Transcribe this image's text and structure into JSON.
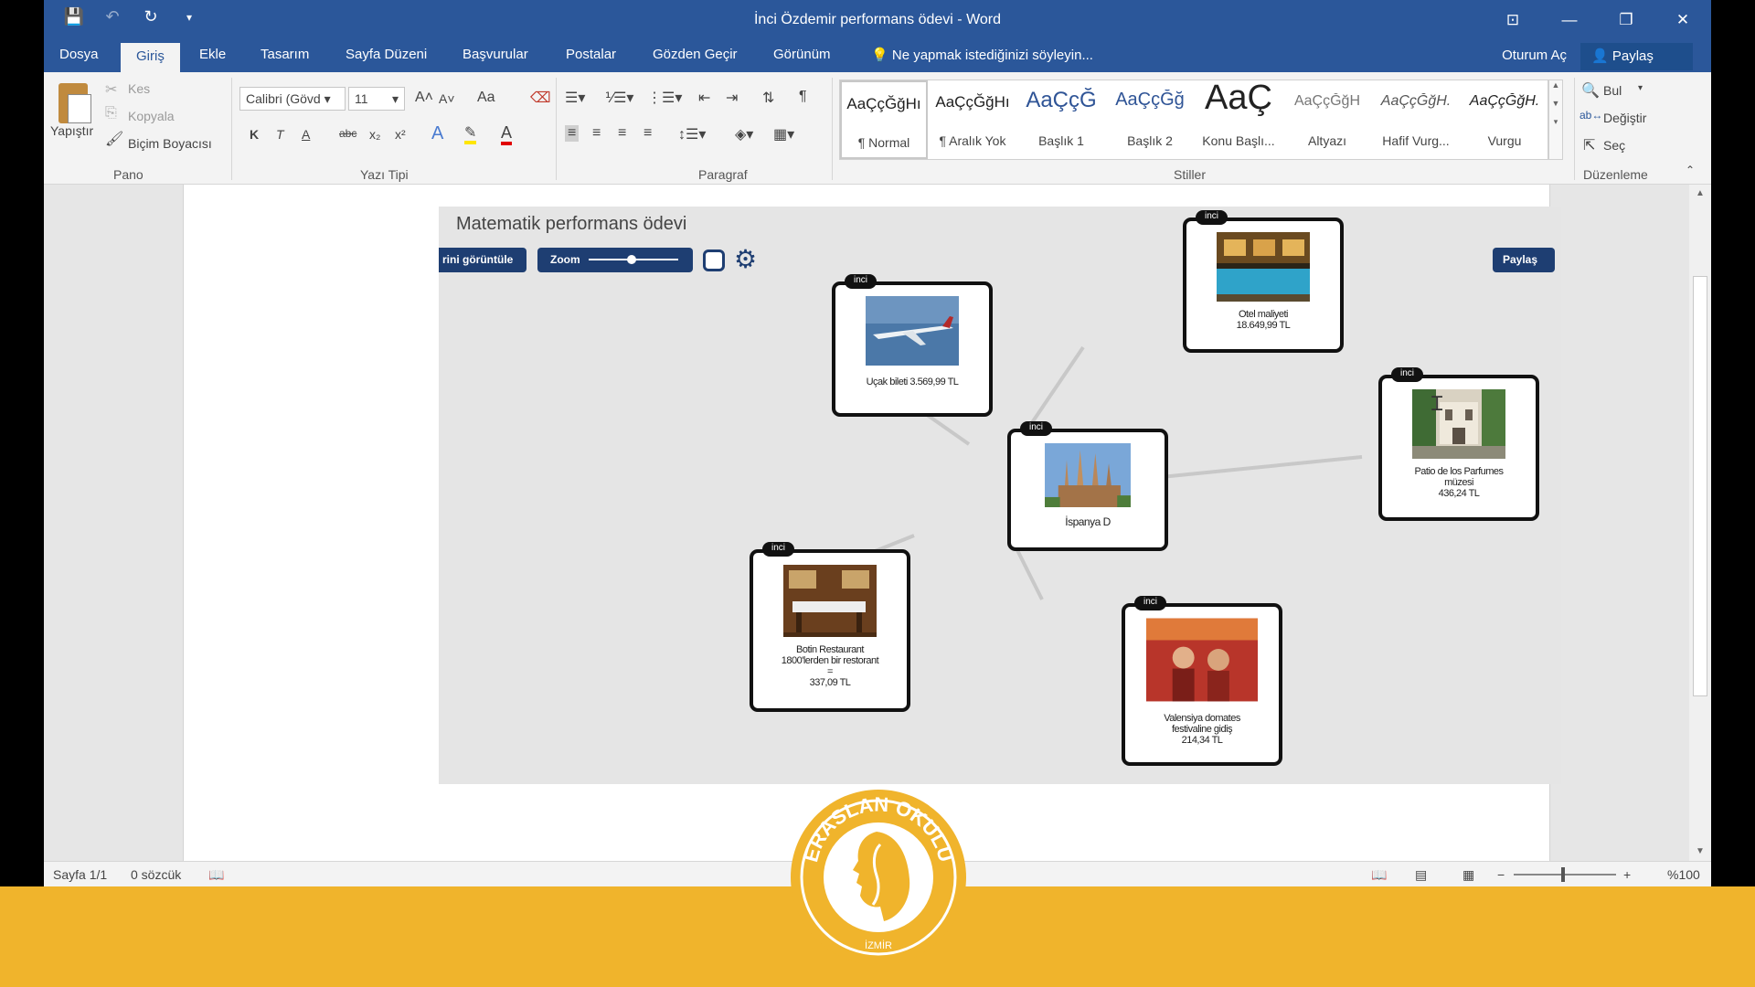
{
  "window": {
    "title": "İnci Özdemir performans ödevi - Word",
    "qat": {
      "save_icon": "save-icon",
      "undo_icon": "undo-icon",
      "redo_icon": "redo-icon",
      "customize_icon": "chevron-down-icon"
    },
    "controls": {
      "ribbon_display": "⊡",
      "minimize": "—",
      "restore": "❐",
      "close": "✕"
    }
  },
  "tabs": [
    {
      "label": "Dosya"
    },
    {
      "label": "Giriş"
    },
    {
      "label": "Ekle"
    },
    {
      "label": "Tasarım"
    },
    {
      "label": "Sayfa Düzeni"
    },
    {
      "label": "Başvurular"
    },
    {
      "label": "Postalar"
    },
    {
      "label": "Gözden Geçir"
    },
    {
      "label": "Görünüm"
    }
  ],
  "tell_me": "Ne yapmak istediğinizi söyleyin...",
  "account": "Oturum Aç",
  "share": "Paylaş",
  "ribbon": {
    "clipboard": {
      "label": "Pano",
      "paste": "Yapıştır",
      "cut": "Kes",
      "copy": "Kopyala",
      "format_painter": "Biçim Boyacısı"
    },
    "font": {
      "label": "Yazı Tipi",
      "font_name": "Calibri (Gövd",
      "font_size": "11",
      "bold": "K",
      "italic": "T",
      "underline": "A",
      "strike": "abc",
      "sub": "x₂",
      "sup": "x²",
      "case": "Aa",
      "grow": "A˄",
      "shrink": "A˅"
    },
    "paragraph": {
      "label": "Paragraf"
    },
    "styles": {
      "label": "Stiller",
      "items": [
        {
          "sample": "AaÇçĞğHı",
          "name": "¶ Normal"
        },
        {
          "sample": "AaÇçĞğHı",
          "name": "¶ Aralık Yok"
        },
        {
          "sample": "AaÇçĞ",
          "name": "Başlık 1"
        },
        {
          "sample": "AaÇçĞğ",
          "name": "Başlık 2"
        },
        {
          "sample": "AaÇ",
          "name": "Konu Başlı..."
        },
        {
          "sample": "AaÇçĞğH",
          "name": "Altyazı"
        },
        {
          "sample": "AaÇçĞğH.",
          "name": "Hafif Vurg..."
        },
        {
          "sample": "AaÇçĞğH.",
          "name": "Vurgu"
        }
      ]
    },
    "editing": {
      "label": "Düzenleme",
      "find": "Bul",
      "replace": "Değiştir",
      "select": "Seç"
    }
  },
  "canvas": {
    "title": "Matematik performans ödevi",
    "view_button": "rini görüntüle",
    "zoom_label": "Zoom",
    "share_button": "Paylaş",
    "cards": [
      {
        "badge": "inci",
        "text": "Uçak bileti 3.569,99 TL",
        "image": "airplane"
      },
      {
        "badge": "inci",
        "text": "Otel maliyeti\n18.649,99 TL",
        "image": "hotel-pool"
      },
      {
        "badge": "inci",
        "text": "İspanya D",
        "image": "sagrada-familia"
      },
      {
        "badge": "inci",
        "text": "Patio de los Parfumes\nmüzesi\n436,24 TL",
        "image": "courtyard"
      },
      {
        "badge": "inci",
        "text": "Botin Restaurant\n1800'lerden bir restorant\n=\n337,09 TL",
        "image": "restaurant"
      },
      {
        "badge": "inci",
        "text": "Valensiya domates\nfestivaline gidiş\n214,34 TL",
        "image": "festival"
      }
    ]
  },
  "status": {
    "page": "Sayfa 1/1",
    "words": "0 sözcük",
    "zoom": "%100"
  },
  "logo": {
    "text": "ERASLAN OKULU",
    "city": "İZMİR",
    "colors": {
      "ring": "#f0b42c",
      "band": "#f0b42c"
    }
  },
  "colors": {
    "word_blue": "#2b579a",
    "canvas_button": "#1e3e72"
  }
}
